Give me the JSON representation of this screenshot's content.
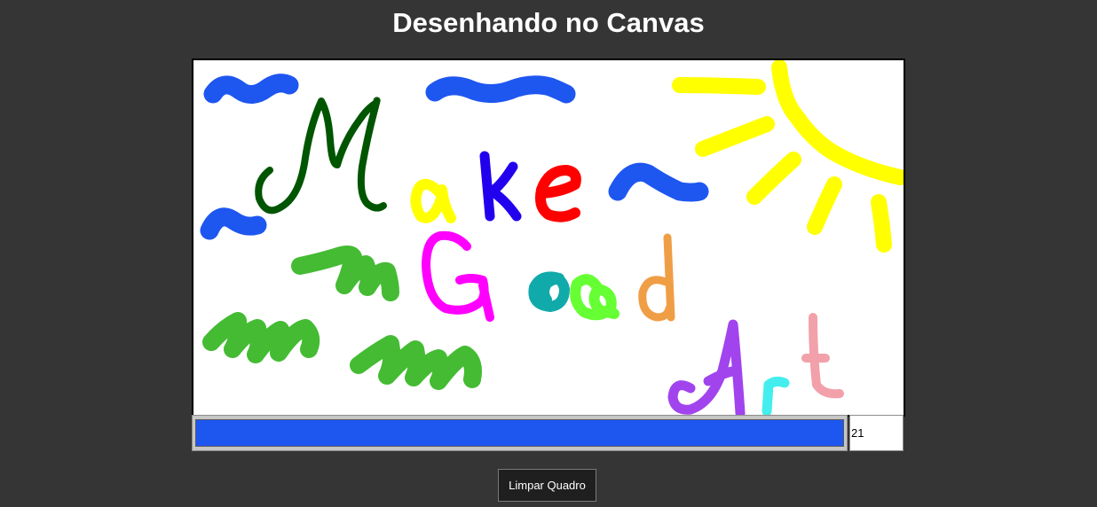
{
  "page": {
    "title": "Desenhando no Canvas"
  },
  "canvas": {
    "background": "#ffffff",
    "drawing_description_colors": [
      "#1e56f0",
      "#005500",
      "#ffff00",
      "#2200ee",
      "#ff0000",
      "#ff00ff",
      "#11aaaa",
      "#66ff33",
      "#f09e45",
      "#a144ee",
      "#44eeee",
      "#f2a0aa",
      "#44bb33"
    ]
  },
  "controls": {
    "color_value": "#1e56f0",
    "brush_size": "21",
    "clear_label": "Limpar Quadro"
  }
}
